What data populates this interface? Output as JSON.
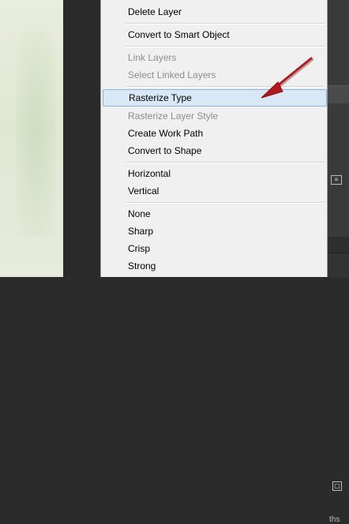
{
  "menu": {
    "items": [
      {
        "label": "Delete Layer",
        "disabled": false
      },
      {
        "label": "Convert to Smart Object",
        "disabled": false
      },
      {
        "label": "Link Layers",
        "disabled": true
      },
      {
        "label": "Select Linked Layers",
        "disabled": true
      },
      {
        "label": "Rasterize Type",
        "disabled": false,
        "highlighted": true
      },
      {
        "label": "Rasterize Layer Style",
        "disabled": true
      },
      {
        "label": "Create Work Path",
        "disabled": false
      },
      {
        "label": "Convert to Shape",
        "disabled": false
      },
      {
        "label": "Horizontal",
        "disabled": false
      },
      {
        "label": "Vertical",
        "disabled": false
      },
      {
        "label": "None",
        "disabled": false
      },
      {
        "label": "Sharp",
        "disabled": false
      },
      {
        "label": "Crisp",
        "disabled": false
      },
      {
        "label": "Strong",
        "disabled": false
      }
    ]
  },
  "panel": {
    "tab_text": "ths"
  },
  "colors": {
    "arrow": "#b3181c",
    "highlight": "#d9e8f7",
    "highlight_border": "#8db2e3",
    "disabled_text": "#8d8d8d"
  }
}
